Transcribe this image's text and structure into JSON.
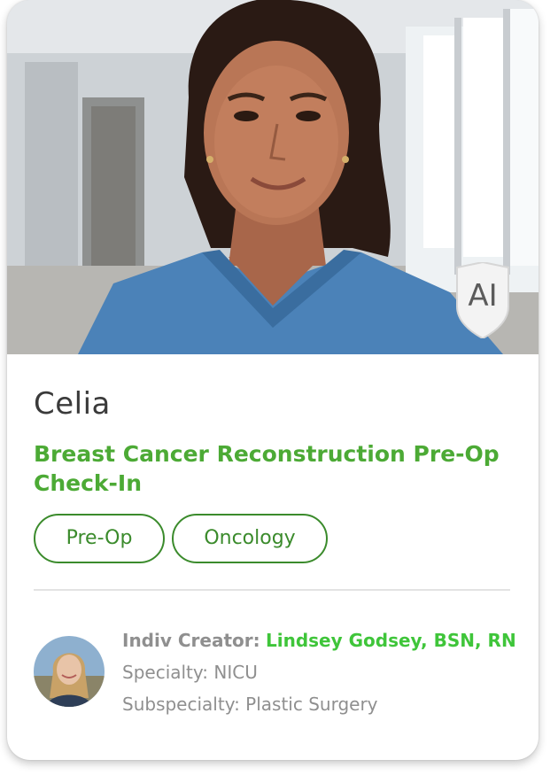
{
  "card": {
    "badge_text": "AI",
    "agent_name": "Celia",
    "program_title": "Breast Cancer Reconstruction Pre-Op Check-In",
    "tags": [
      "Pre-Op",
      "Oncology"
    ],
    "creator": {
      "label": "Indiv Creator:",
      "name": "Lindsey Godsey, BSN, RN",
      "specialty": "Specialty: NICU",
      "subspecialty": "Subspecialty: Plastic Surgery"
    }
  },
  "colors": {
    "accent_green": "#4caa35",
    "tag_green": "#3b8b2c",
    "creator_green": "#3fc53a",
    "text_dark": "#3a3a3a",
    "text_muted": "#8f8f8f"
  },
  "icons": {
    "badge": "ai-shield-icon"
  }
}
